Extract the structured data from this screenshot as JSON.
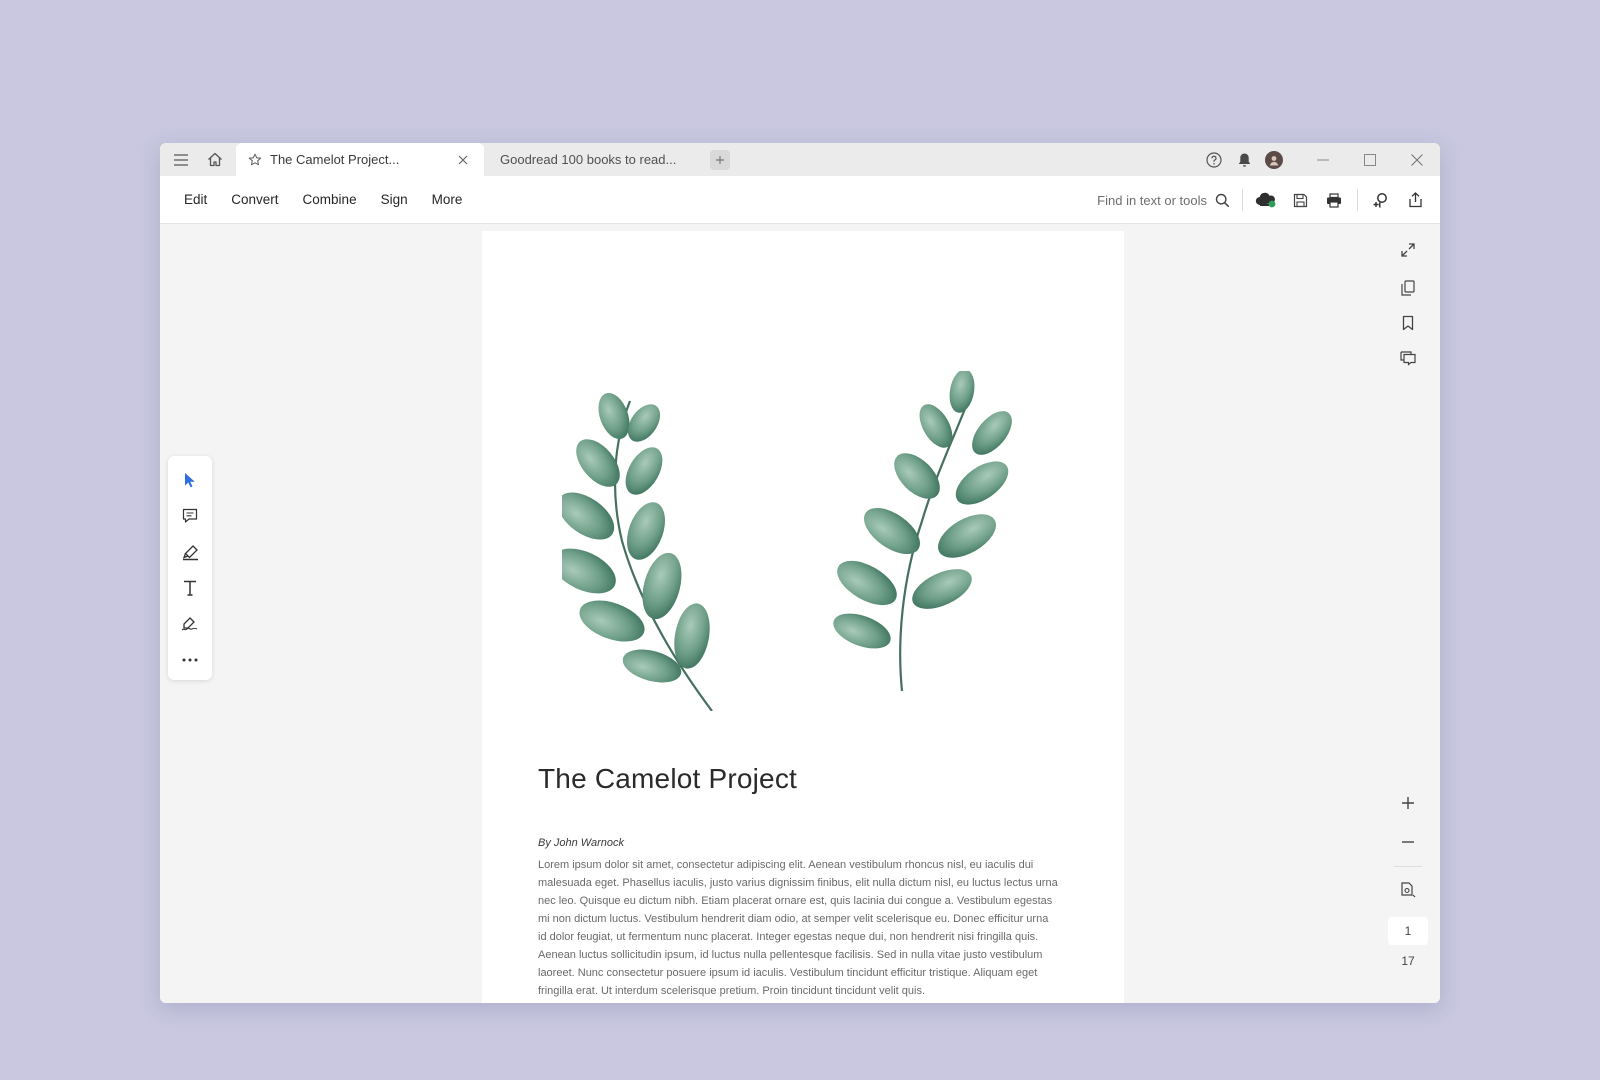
{
  "titlebar": {
    "menu_icon": "hamburger-icon",
    "home_icon": "home-icon",
    "tabs": [
      {
        "label": "The Camelot Project...",
        "active": true,
        "icon": "star-icon"
      },
      {
        "label": "Goodread 100 books to read...",
        "active": false
      }
    ],
    "new_tab_icon": "plus-icon",
    "right_icons": [
      "help-icon",
      "bell-icon",
      "avatar"
    ]
  },
  "toolbar": {
    "menu": [
      "Edit",
      "Convert",
      "Combine",
      "Sign",
      "More"
    ],
    "search_placeholder": "Find in text or tools"
  },
  "document": {
    "title": "The Camelot Project",
    "author": "By John Warnock",
    "body": "Lorem ipsum dolor sit amet, consectetur adipiscing elit. Aenean vestibulum rhoncus nisl, eu iaculis dui malesuada eget. Phasellus iaculis, justo varius dignissim finibus, elit nulla dictum nisl, eu luctus lectus urna nec leo. Quisque eu dictum nibh. Etiam placerat ornare est, quis lacinia dui congue a. Vestibulum egestas mi non dictum luctus. Vestibulum hendrerit diam odio, at semper velit scelerisque eu. Donec efficitur urna id dolor feugiat, ut fermentum nunc placerat. Integer egestas neque dui, non hendrerit nisi fringilla quis. Aenean luctus sollicitudin ipsum, id luctus nulla pellentesque facilisis. Sed in nulla vitae justo vestibulum laoreet. Nunc consectetur posuere ipsum id iaculis. Vestibulum tincidunt efficitur tristique. Aliquam eget fringilla erat. Ut interdum scelerisque pretium. Proin tincidunt tincidunt velit quis."
  },
  "pager": {
    "current_page": "1",
    "total_pages": "17"
  },
  "colors": {
    "background": "#c9c8e0",
    "accent": "#2f6fe0",
    "leaf_green": "#4f8a72",
    "cloud_status": "#2e9c5a"
  }
}
